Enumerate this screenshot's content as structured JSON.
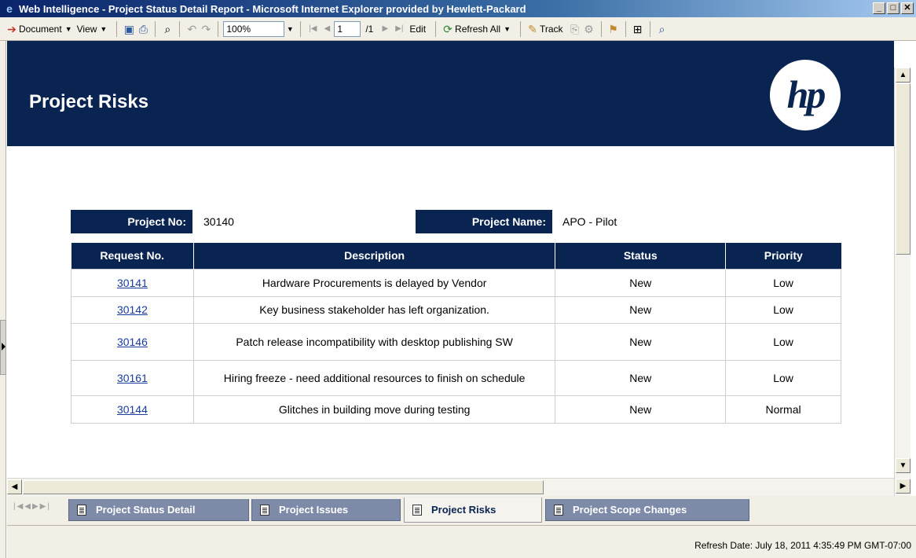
{
  "window": {
    "title": "Web Intelligence - Project Status Detail Report - Microsoft Internet Explorer provided by Hewlett-Packard",
    "minimize": "_",
    "maximize": "□",
    "close": "✕"
  },
  "toolbar": {
    "document_label": "Document",
    "view_label": "View",
    "zoom_value": "100%",
    "page_current": "1",
    "page_total": "/1",
    "edit_label": "Edit",
    "refresh_all_label": "Refresh All",
    "track_label": "Track"
  },
  "report": {
    "title": "Project Risks",
    "logo_text": "hp",
    "project_no_label": "Project No:",
    "project_no_value": "30140",
    "project_name_label": "Project Name:",
    "project_name_value": "APO - Pilot",
    "columns": [
      "Request No.",
      "Description",
      "Status",
      "Priority"
    ],
    "rows": [
      {
        "request": "30141",
        "description": "Hardware Procurements is delayed by Vendor",
        "status": "New",
        "priority": "Low"
      },
      {
        "request": "30142",
        "description": "Key business stakeholder has left organization.",
        "status": "New",
        "priority": "Low"
      },
      {
        "request": "30146",
        "description": "Patch release incompatibility with desktop publishing SW",
        "status": "New",
        "priority": "Low"
      },
      {
        "request": "30161",
        "description": "Hiring freeze - need additional resources to finish on schedule",
        "status": "New",
        "priority": "Low"
      },
      {
        "request": "30144",
        "description": "Glitches in building move during testing",
        "status": "New",
        "priority": "Normal"
      }
    ]
  },
  "tabs": [
    {
      "label": "Project Status Detail",
      "active": false
    },
    {
      "label": "Project Issues",
      "active": false
    },
    {
      "label": "Project Risks",
      "active": true
    },
    {
      "label": "Project Scope Changes",
      "active": false
    }
  ],
  "status": {
    "refresh_date": "Refresh Date: July 18, 2011 4:35:49 PM GMT-07:00"
  },
  "colors": {
    "banner": "#0a2452",
    "tab_inactive": "#7d8aa8",
    "link": "#1a3c9e"
  }
}
